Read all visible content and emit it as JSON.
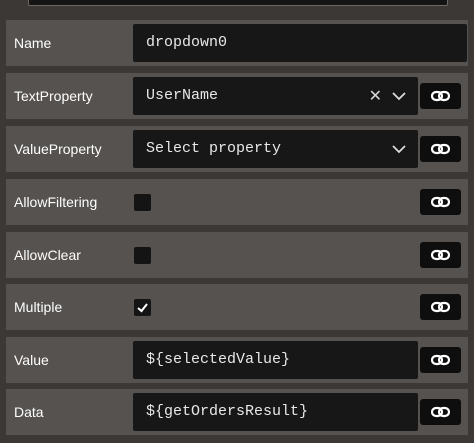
{
  "properties": [
    {
      "key": "name",
      "label": "Name",
      "kind": "text",
      "value": "dropdown0"
    },
    {
      "key": "text-property",
      "label": "TextProperty",
      "kind": "select",
      "value": "UserName",
      "clearable": true
    },
    {
      "key": "value-property",
      "label": "ValueProperty",
      "kind": "select",
      "value": "Select property",
      "clearable": false
    },
    {
      "key": "allow-filtering",
      "label": "AllowFiltering",
      "kind": "checkbox",
      "checked": false
    },
    {
      "key": "allow-clear",
      "label": "AllowClear",
      "kind": "checkbox",
      "checked": false
    },
    {
      "key": "multiple",
      "label": "Multiple",
      "kind": "checkbox",
      "checked": true
    },
    {
      "key": "value",
      "label": "Value",
      "kind": "text",
      "value": "${selectedValue}"
    },
    {
      "key": "data",
      "label": "Data",
      "kind": "text",
      "value": "${getOrdersResult}"
    }
  ],
  "icons": {
    "clear": "close-icon",
    "chevron": "chevron-down-icon",
    "link": "link-icon",
    "check": "check-icon"
  },
  "colors": {
    "panel_bg": "#3b3836",
    "row_bg": "#55524f",
    "field_bg": "#171717",
    "button_bg": "#0e0e0e",
    "text": "#ffffff"
  }
}
